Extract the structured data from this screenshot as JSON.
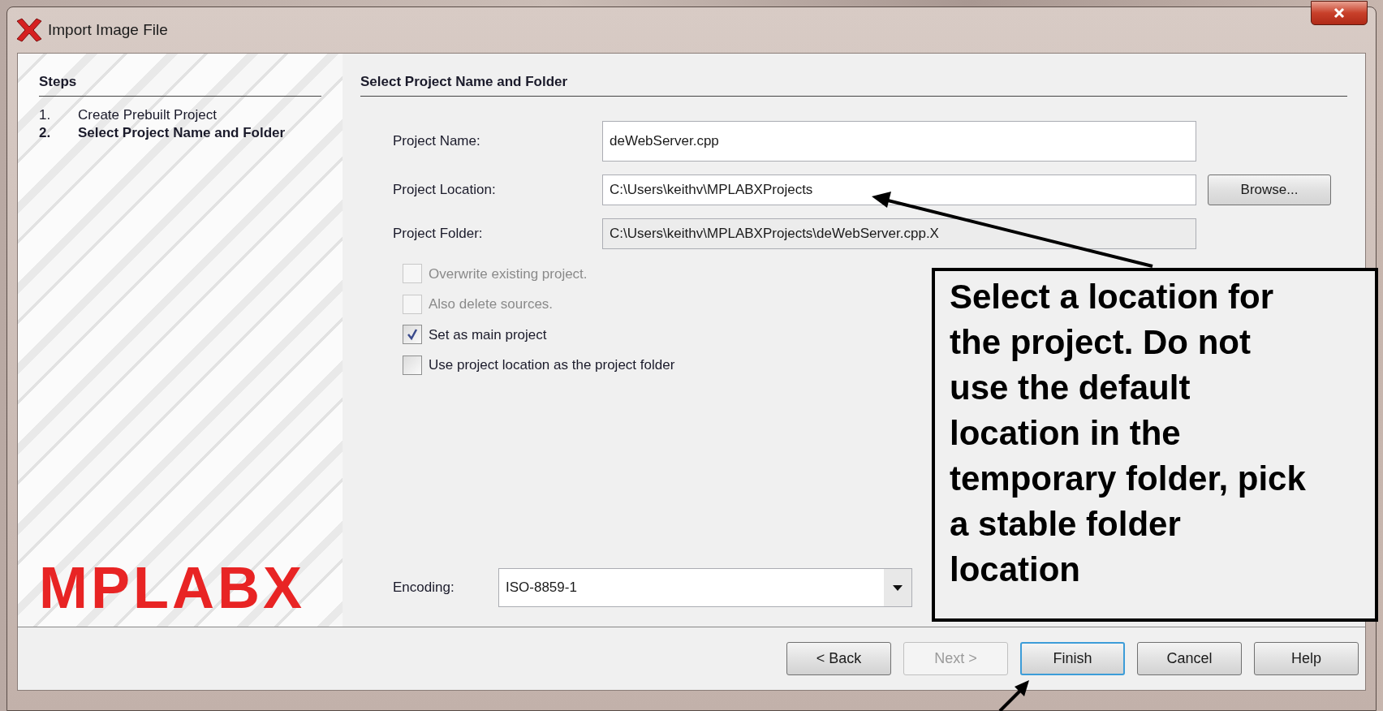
{
  "window": {
    "title": "Import Image File"
  },
  "steps": {
    "heading": "Steps",
    "items": [
      {
        "number": "1.",
        "label": "Create Prebuilt Project",
        "selected": false
      },
      {
        "number": "2.",
        "label": "Select Project Name and Folder",
        "selected": true
      }
    ]
  },
  "logo": "MPLABX",
  "panel": {
    "heading": "Select Project Name and Folder",
    "fields": [
      {
        "label": "Project Name:",
        "value": "deWebServer.cpp",
        "disabled": false
      },
      {
        "label": "Project Location:",
        "value": "C:\\Users\\keithv\\MPLABXProjects",
        "disabled": false,
        "button": "Browse..."
      },
      {
        "label": "Project Folder:",
        "value": "C:\\Users\\keithv\\MPLABXProjects\\deWebServer.cpp.X",
        "disabled": true
      }
    ],
    "checkboxes": [
      {
        "label": "Overwrite existing project.",
        "checked": false,
        "disabled": true
      },
      {
        "label": "Also delete sources.",
        "checked": false,
        "disabled": true
      },
      {
        "label": "Set as main project",
        "checked": true,
        "disabled": false
      },
      {
        "label": "Use project location as the project folder",
        "checked": false,
        "disabled": false
      }
    ],
    "encoding": {
      "label": "Encoding:",
      "value": "ISO-8859-1"
    }
  },
  "buttons": [
    {
      "label": "< Back",
      "disabled": false,
      "focused": false
    },
    {
      "label": "Next >",
      "disabled": true,
      "focused": false
    },
    {
      "label": "Finish",
      "disabled": false,
      "focused": true
    },
    {
      "label": "Cancel",
      "disabled": false,
      "focused": false
    },
    {
      "label": "Help",
      "disabled": false,
      "focused": false
    }
  ],
  "callout": {
    "lines": [
      "Select a location for",
      "the project. Do not",
      "use the default",
      "location in the",
      "temporary folder, pick",
      "a stable folder",
      "location"
    ]
  }
}
